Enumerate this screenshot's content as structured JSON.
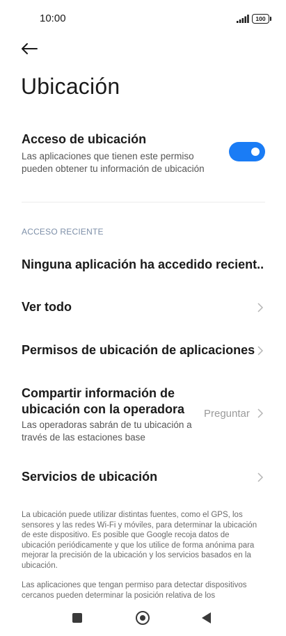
{
  "status_bar": {
    "time": "10:00",
    "battery_level": "100"
  },
  "header": {
    "title": "Ubicación"
  },
  "location_access": {
    "title": "Acceso de ubicación",
    "description": "Las aplicaciones que tienen este permiso pueden obtener tu información de ubicación",
    "enabled": true,
    "toggle_color": "#1a7cf5"
  },
  "recent_access": {
    "section_label": "ACCESO RECIENTE",
    "no_apps": "Ninguna aplicación ha accedido recient.."
  },
  "list": {
    "see_all": "Ver todo",
    "app_permissions": "Permisos de ubicación de aplicaciones",
    "carrier_share_title": "Compartir información de ubicación con la operadora",
    "carrier_share_value": "Preguntar",
    "carrier_share_desc": "Las operadoras sabrán de tu ubicación a través de las estaciones base",
    "location_services": "Servicios de ubicación"
  },
  "footer": {
    "paragraph1": "La ubicación puede utilizar distintas fuentes, como el GPS, los sensores y las redes Wi-Fi y móviles, para determinar la ubicación de este dispositivo. Es posible que Google recoja datos de ubicación periódicamente y que los utilice de forma anónima para mejorar la precisión de la ubicación y los servicios basados en la ubicación.",
    "paragraph2": "Las aplicaciones que tengan permiso para detectar dispositivos cercanos pueden determinar la posición relativa de los"
  },
  "icons": {
    "back": "arrow-left-icon",
    "chevron": "chevron-right-icon",
    "signal": "signal-icon",
    "battery": "battery-icon"
  }
}
